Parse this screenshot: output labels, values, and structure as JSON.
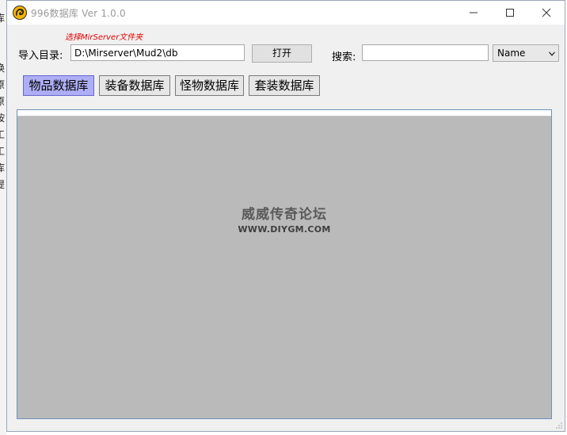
{
  "window": {
    "title": "996数据库 Ver 1.0.0"
  },
  "background_window": {
    "chars": [
      "库",
      "换",
      "原",
      "原",
      "按",
      "工",
      "工",
      "库",
      "提"
    ]
  },
  "toolbar": {
    "hint": "选择MirServer文件夹",
    "import_label": "导入目录:",
    "path_value": "D:\\Mirserver\\Mud2\\db",
    "open_label": "打开",
    "search_label": "搜索:",
    "search_value": "",
    "search_field_selected": "Name"
  },
  "tabs": [
    {
      "label": "物品数据库",
      "active": true
    },
    {
      "label": "装备数据库",
      "active": false
    },
    {
      "label": "怪物数据库",
      "active": false
    },
    {
      "label": "套装数据库",
      "active": false
    }
  ],
  "watermark": {
    "cn": "威威传奇论坛",
    "en": "WWW.DIYGM.COM"
  },
  "colors": {
    "active_tab": "#aeaef6",
    "panel_bg": "#bababa",
    "hint_text": "#e00000",
    "window_bg": "#f0f0f0",
    "app_icon": "#f2b400"
  },
  "icons": {
    "app": "dragon-logo-icon",
    "minimize": "minimize-icon",
    "maximize": "maximize-icon",
    "close": "close-icon",
    "dropdown": "chevron-down-icon",
    "resize": "resize-grip-icon"
  }
}
